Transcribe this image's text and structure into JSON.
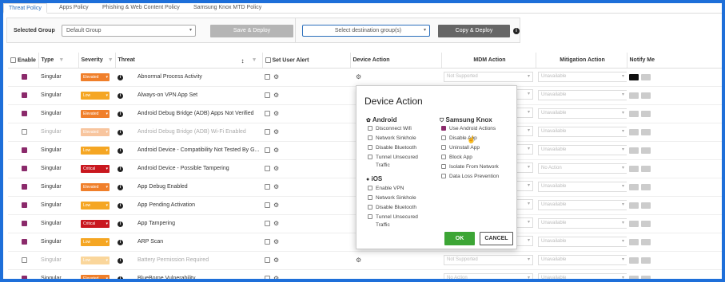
{
  "tabs": [
    {
      "label": "Threat Policy"
    },
    {
      "label": "Apps Policy"
    },
    {
      "label": "Phishing & Web Content Policy"
    },
    {
      "label": "Samsung Knox MTD Policy"
    }
  ],
  "toolbar": {
    "group_label": "Selected Group",
    "group_value": "Default Group",
    "save_deploy": "Save & Deploy",
    "dest_placeholder": "Select destination group(s)",
    "copy_deploy": "Copy & Deploy"
  },
  "columns": {
    "enable": "Enable",
    "type": "Type",
    "severity": "Severity",
    "threat": "Threat",
    "set_user_alert": "Set User Alert",
    "device_action": "Device Action",
    "mdm_action": "MDM Action",
    "mitigation_action": "Mitigation Action",
    "notify_me": "Notify Me"
  },
  "severity_colors": {
    "Elevated": "#f07f2a",
    "Low": "#f5a623",
    "Critical": "#c9171e"
  },
  "rows": [
    {
      "enabled": true,
      "type": "Singular",
      "severity": "Elevated",
      "threat": "Abnormal Process Activity",
      "mdm": "Not Supported",
      "mitigation": "Unavailable",
      "dim": false
    },
    {
      "enabled": true,
      "type": "Singular",
      "severity": "Low",
      "threat": "Always-on VPN App Set",
      "mdm": "",
      "mitigation": "Unavailable",
      "dim": false
    },
    {
      "enabled": true,
      "type": "Singular",
      "severity": "Elevated",
      "threat": "Android Debug Bridge (ADB) Apps Not Verified",
      "mdm": "",
      "mitigation": "Unavailable",
      "dim": false
    },
    {
      "enabled": false,
      "type": "Singular",
      "severity": "Elevated",
      "threat": "Android Debug Bridge (ADB) Wi-Fi Enabled",
      "mdm": "",
      "mitigation": "Unavailable",
      "dim": true
    },
    {
      "enabled": true,
      "type": "Singular",
      "severity": "Low",
      "threat": "Android Device - Compatibility Not Tested By G...",
      "mdm": "",
      "mitigation": "Unavailable",
      "dim": false
    },
    {
      "enabled": true,
      "type": "Singular",
      "severity": "Critical",
      "threat": "Android Device - Possible Tampering",
      "mdm": "",
      "mitigation": "No Action",
      "dim": false
    },
    {
      "enabled": true,
      "type": "Singular",
      "severity": "Elevated",
      "threat": "App Debug Enabled",
      "mdm": "",
      "mitigation": "Unavailable",
      "dim": false
    },
    {
      "enabled": true,
      "type": "Singular",
      "severity": "Low",
      "threat": "App Pending Activation",
      "mdm": "",
      "mitigation": "Unavailable",
      "dim": false
    },
    {
      "enabled": true,
      "type": "Singular",
      "severity": "Critical",
      "threat": "App Tampering",
      "mdm": "",
      "mitigation": "Unavailable",
      "dim": false
    },
    {
      "enabled": true,
      "type": "Singular",
      "severity": "Low",
      "threat": "ARP Scan",
      "mdm": "",
      "mitigation": "Unavailable",
      "dim": false
    },
    {
      "enabled": false,
      "type": "Singular",
      "severity": "Low",
      "threat": "Battery Permission Required",
      "mdm": "Not Supported",
      "mitigation": "Unavailable",
      "dim": true
    },
    {
      "enabled": true,
      "type": "Singular",
      "severity": "Elevated",
      "threat": "BlueBorne Vulnerability",
      "mdm": "No Action",
      "mitigation": "Unavailable",
      "dim": false
    }
  ],
  "popup": {
    "title": "Device Action",
    "android_title": "Android",
    "android_options": [
      "Disconnect Wifi",
      "Network Sinkhole",
      "Disable Bluetooth",
      "Tunnel Unsecured",
      "Traffic"
    ],
    "ios_title": "iOS",
    "ios_options": [
      "Enable VPN",
      "Network Sinkhole",
      "Disable Bluetooth",
      "Tunnel Unsecured",
      "Traffic"
    ],
    "knox_title": "Samsung Knox",
    "knox_options": [
      "Use Android Actions",
      "Disable App",
      "Uninstall App",
      "Block App",
      "Isolate From Network",
      "Data Loss Prevention"
    ],
    "ok": "OK",
    "cancel": "CANCEL"
  }
}
